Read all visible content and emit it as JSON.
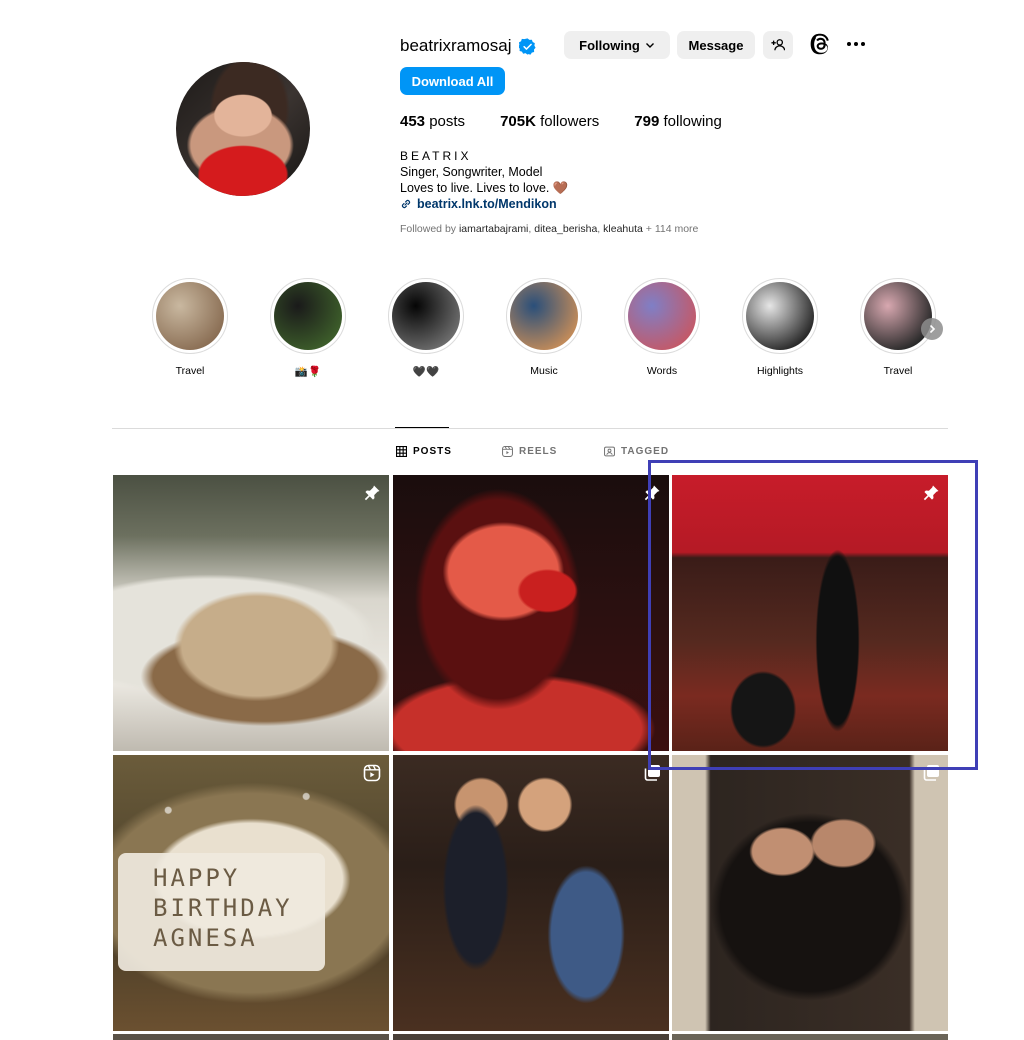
{
  "profile": {
    "username": "beatrixramosaj",
    "verified": true,
    "buttons": {
      "following": "Following",
      "message": "Message",
      "download": "Download All"
    },
    "stats": {
      "posts_count": "453",
      "posts_label": "posts",
      "followers_count": "705K",
      "followers_label": "followers",
      "following_count": "799",
      "following_label": "following"
    },
    "bio": {
      "full_name": "BEATRIX",
      "line1": "Singer, Songwriter, Model",
      "line2": "Loves to live. Lives to love.",
      "emoji": "🤎",
      "link": "beatrix.lnk.to/Mendikon"
    },
    "followed_by": {
      "prefix": "Followed by",
      "names": "iamartabajrami",
      "name2": "ditea_berisha",
      "name3": "kleahuta",
      "more": "+ 114 more"
    }
  },
  "highlights": [
    {
      "label": "Travel",
      "colors": [
        "#c9b8a0",
        "#8b6f55"
      ]
    },
    {
      "label": "📸🌹",
      "colors": [
        "#1a1a1a",
        "#3c5c2a"
      ]
    },
    {
      "label": "🖤🖤",
      "colors": [
        "#050505",
        "#6b6b6b"
      ]
    },
    {
      "label": "Music",
      "colors": [
        "#2a4f7a",
        "#c08a5a"
      ]
    },
    {
      "label": "Words",
      "colors": [
        "#7f7fc6",
        "#c25a6a"
      ]
    },
    {
      "label": "Highlights",
      "colors": [
        "#e6e6e6",
        "#2a2a2a"
      ]
    },
    {
      "label": "Travel",
      "colors": [
        "#d8a8b0",
        "#2a2a2a"
      ]
    }
  ],
  "tabs": {
    "posts": "POSTS",
    "reels": "REELS",
    "tagged": "TAGGED"
  },
  "grid": {
    "cake_text_1": "HAPPY",
    "cake_text_2": "BIRTHDAY",
    "cake_text_3": "AGNESA",
    "icons": [
      "pin-icon",
      "pin-icon",
      "pin-icon",
      "reel-icon",
      "carousel-icon",
      "carousel-icon"
    ]
  },
  "colors": {
    "accent": "#0095f6",
    "verified": "#0095f6",
    "link": "#00376b",
    "selection": "#3f3fb6"
  }
}
